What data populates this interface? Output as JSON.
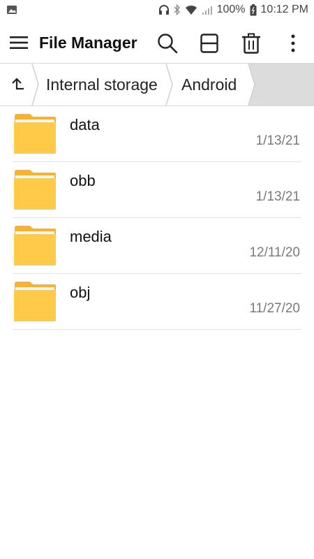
{
  "status_bar": {
    "battery_percent": "100%",
    "time": "10:12 PM",
    "icons": [
      "image-icon",
      "headset-icon",
      "bluetooth-icon",
      "wifi-icon",
      "signal-icon",
      "battery-icon"
    ]
  },
  "toolbar": {
    "title": "File Manager",
    "icons": [
      "menu-icon",
      "search-icon",
      "view-toggle-icon",
      "trash-icon",
      "more-icon"
    ]
  },
  "breadcrumb": {
    "items": [
      "Internal storage",
      "Android"
    ]
  },
  "files": [
    {
      "name": "data",
      "date": "1/13/21"
    },
    {
      "name": "obb",
      "date": "1/13/21"
    },
    {
      "name": "media",
      "date": "12/11/20"
    },
    {
      "name": "obj",
      "date": "11/27/20"
    }
  ],
  "colors": {
    "folder": "#FFCA47",
    "folder_tab": "#F9B22E",
    "date_text": "#7a7a7a",
    "breadcrumb_fill": "#dcdcdc"
  }
}
